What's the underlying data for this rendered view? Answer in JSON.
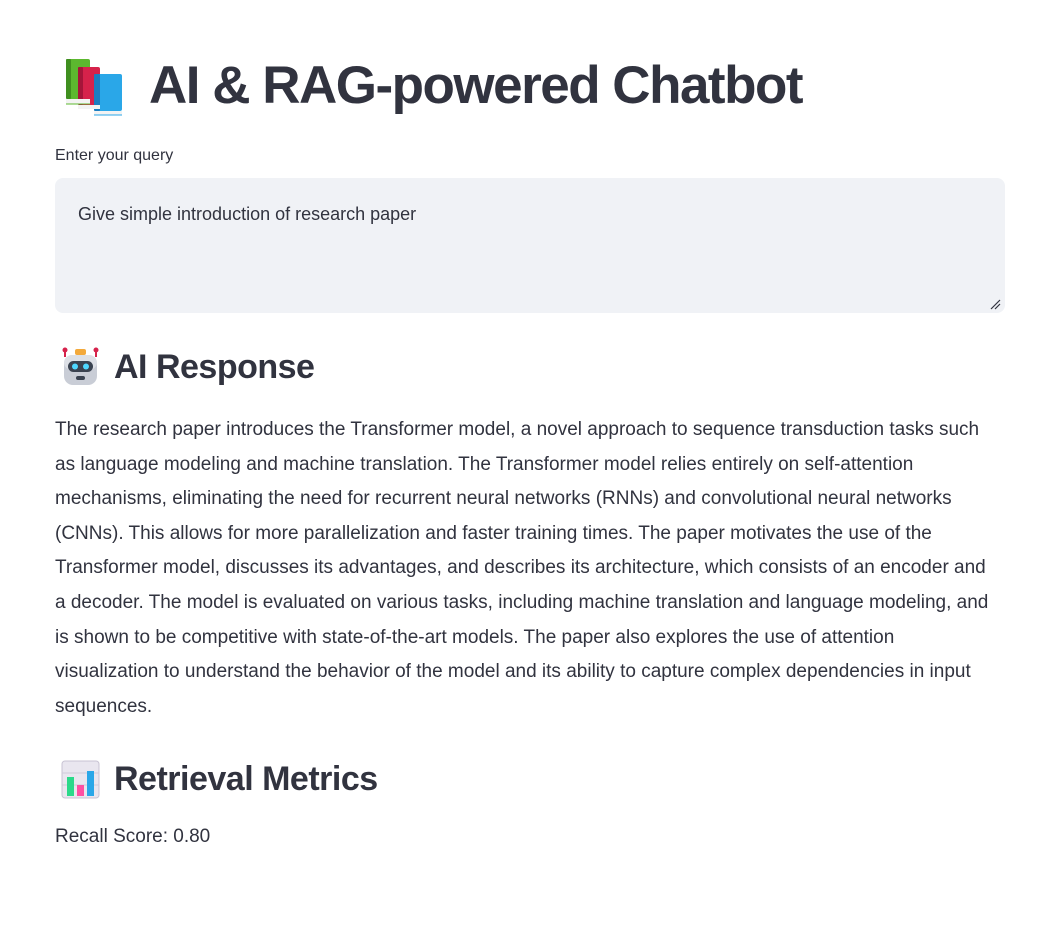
{
  "header": {
    "title": "AI & RAG-powered Chatbot",
    "icon": "books-icon"
  },
  "query": {
    "label": "Enter your query",
    "value": "Give simple introduction of research paper"
  },
  "response": {
    "icon": "robot-icon",
    "title": "AI Response",
    "text": "The research paper introduces the Transformer model, a novel approach to sequence transduction tasks such as language modeling and machine translation. The Transformer model relies entirely on self-attention mechanisms, eliminating the need for recurrent neural networks (RNNs) and convolutional neural networks (CNNs). This allows for more parallelization and faster training times. The paper motivates the use of the Transformer model, discusses its advantages, and describes its architecture, which consists of an encoder and a decoder. The model is evaluated on various tasks, including machine translation and language modeling, and is shown to be competitive with state-of-the-art models. The paper also explores the use of attention visualization to understand the behavior of the model and its ability to capture complex dependencies in input sequences."
  },
  "metrics": {
    "icon": "bar-chart-icon",
    "title": "Retrieval Metrics",
    "recall_text": "Recall Score: 0.80"
  },
  "colors": {
    "text": "#31333f",
    "input_background": "#f0f2f6",
    "page_background": "#ffffff"
  }
}
